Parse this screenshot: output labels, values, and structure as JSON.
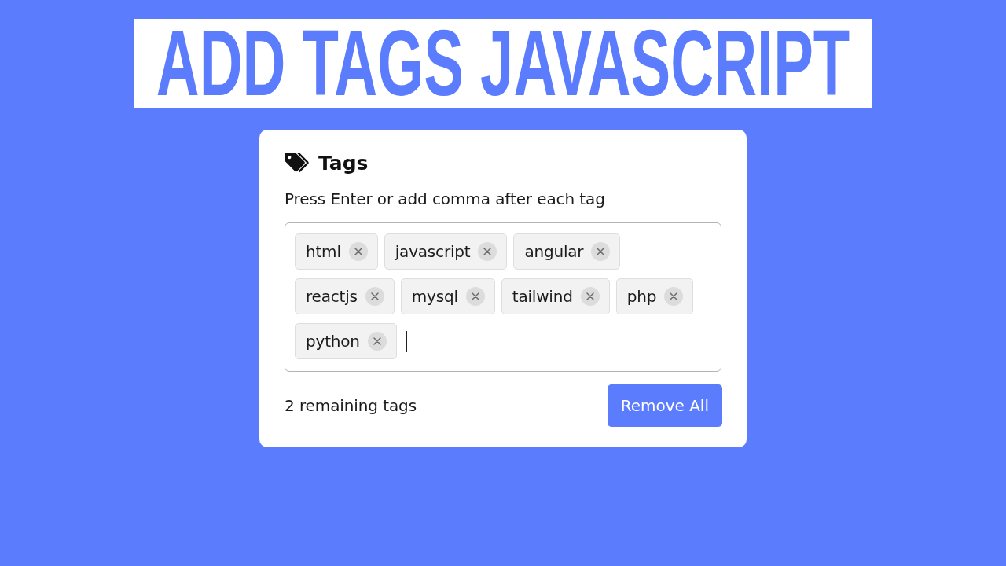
{
  "banner": {
    "title": "ADD TAGS JAVASCRIPT"
  },
  "card": {
    "title": "Tags",
    "hint": "Press Enter or add comma after each tag",
    "tags": [
      {
        "label": "html"
      },
      {
        "label": "javascript"
      },
      {
        "label": "angular"
      },
      {
        "label": "reactjs"
      },
      {
        "label": "mysql"
      },
      {
        "label": "tailwind"
      },
      {
        "label": "php"
      },
      {
        "label": "python"
      }
    ],
    "input": {
      "focused": true
    },
    "remaining": "2 remaining tags",
    "remove_all_button": "Remove All"
  }
}
